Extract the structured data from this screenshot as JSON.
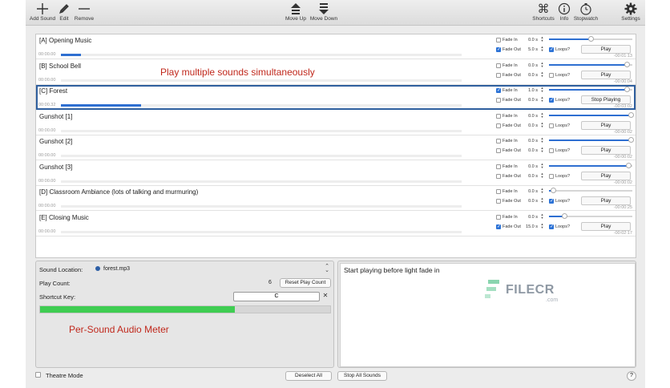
{
  "toolbar": {
    "add_sound": "Add Sound",
    "edit": "Edit",
    "remove": "Remove",
    "move_up": "Move Up",
    "move_down": "Move Down",
    "shortcuts": "Shortcuts",
    "info": "Info",
    "stopwatch": "Stopwatch",
    "settings": "Settings"
  },
  "labels": {
    "fade_in": "Fade In",
    "fade_out": "Fade Out",
    "loops": "Loops?"
  },
  "sounds": [
    {
      "name": "[A] Opening Music",
      "elapsed": "00:00.00",
      "progress": 0.05,
      "fade_in_checked": false,
      "fade_in_value": "0.0 s",
      "fade_out_checked": true,
      "fade_out_value": "5.0 s",
      "volume": 0.5,
      "loops_checked": true,
      "play_label": "Play",
      "remaining": "-00:01:13",
      "selected": false
    },
    {
      "name": "[B] School Bell",
      "elapsed": "00:00.00",
      "progress": 0.0,
      "fade_in_checked": false,
      "fade_in_value": "0.0 s",
      "fade_out_checked": false,
      "fade_out_value": "0.0 s",
      "volume": 0.93,
      "loops_checked": false,
      "play_label": "Play",
      "remaining": "-00:00:04",
      "selected": false
    },
    {
      "name": "[C] Forest",
      "elapsed": "00:00.32",
      "progress": 0.2,
      "fade_in_checked": true,
      "fade_in_value": "1.0 s",
      "fade_out_checked": false,
      "fade_out_value": "0.0 s",
      "volume": 0.93,
      "loops_checked": true,
      "play_label": "Stop Playing",
      "remaining": "-00:03:02",
      "selected": true
    },
    {
      "name": "Gunshot [1]",
      "elapsed": "00:00.00",
      "progress": 0.0,
      "fade_in_checked": false,
      "fade_in_value": "0.0 s",
      "fade_out_checked": false,
      "fade_out_value": "0.0 s",
      "volume": 0.98,
      "loops_checked": false,
      "play_label": "Play",
      "remaining": "-00:00:02",
      "selected": false
    },
    {
      "name": "Gunshot [2]",
      "elapsed": "00:00.00",
      "progress": 0.0,
      "fade_in_checked": false,
      "fade_in_value": "0.0 s",
      "fade_out_checked": false,
      "fade_out_value": "0.0 s",
      "volume": 0.98,
      "loops_checked": false,
      "play_label": "Play",
      "remaining": "-00:00:02",
      "selected": false
    },
    {
      "name": "Gunshot [3]",
      "elapsed": "00:00.00",
      "progress": 0.0,
      "fade_in_checked": false,
      "fade_in_value": "0.0 s",
      "fade_out_checked": false,
      "fade_out_value": "0.0 s",
      "volume": 0.95,
      "loops_checked": false,
      "play_label": "Play",
      "remaining": "-00:00:02",
      "selected": false
    },
    {
      "name": "[D] Classroom Ambiance (lots of talking and murmuring)",
      "elapsed": "00:00.00",
      "progress": 0.0,
      "fade_in_checked": false,
      "fade_in_value": "0.0 s",
      "fade_out_checked": false,
      "fade_out_value": "0.0 s",
      "volume": 0.05,
      "loops_checked": true,
      "play_label": "Play",
      "remaining": "-00:00:25",
      "selected": false
    },
    {
      "name": "[E] Closing Music",
      "elapsed": "00:00.00",
      "progress": 0.0,
      "fade_in_checked": false,
      "fade_in_value": "0.0 s",
      "fade_out_checked": true,
      "fade_out_value": "15.0 s",
      "volume": 0.18,
      "loops_checked": true,
      "play_label": "Play",
      "remaining": "-00:02:17",
      "selected": false
    }
  ],
  "annotations": {
    "top": "Play multiple sounds simultaneously",
    "meter": "Per-Sound Audio Meter"
  },
  "detail": {
    "sound_location_label": "Sound Location:",
    "sound_location_value": "forest.mp3",
    "play_count_label": "Play Count:",
    "play_count_value": "6",
    "reset_play_count": "Reset Play Count",
    "shortcut_key_label": "Shortcut Key:",
    "shortcut_key_value": "C",
    "clear_symbol": "✕",
    "meter_level": 0.67,
    "notes": "Start playing before light fade in"
  },
  "watermark": {
    "text": "FILECR",
    "sub": ".com"
  },
  "bottom": {
    "theatre_mode": "Theatre Mode",
    "deselect_all": "Deselect All",
    "stop_all_sounds": "Stop All Sounds",
    "help": "?"
  },
  "colors": {
    "accent": "#2e6fd1",
    "meter": "#3fcd52",
    "annotation": "#c0281c",
    "selection": "#2f5f9e",
    "watermark_green": "#3cb97a"
  }
}
